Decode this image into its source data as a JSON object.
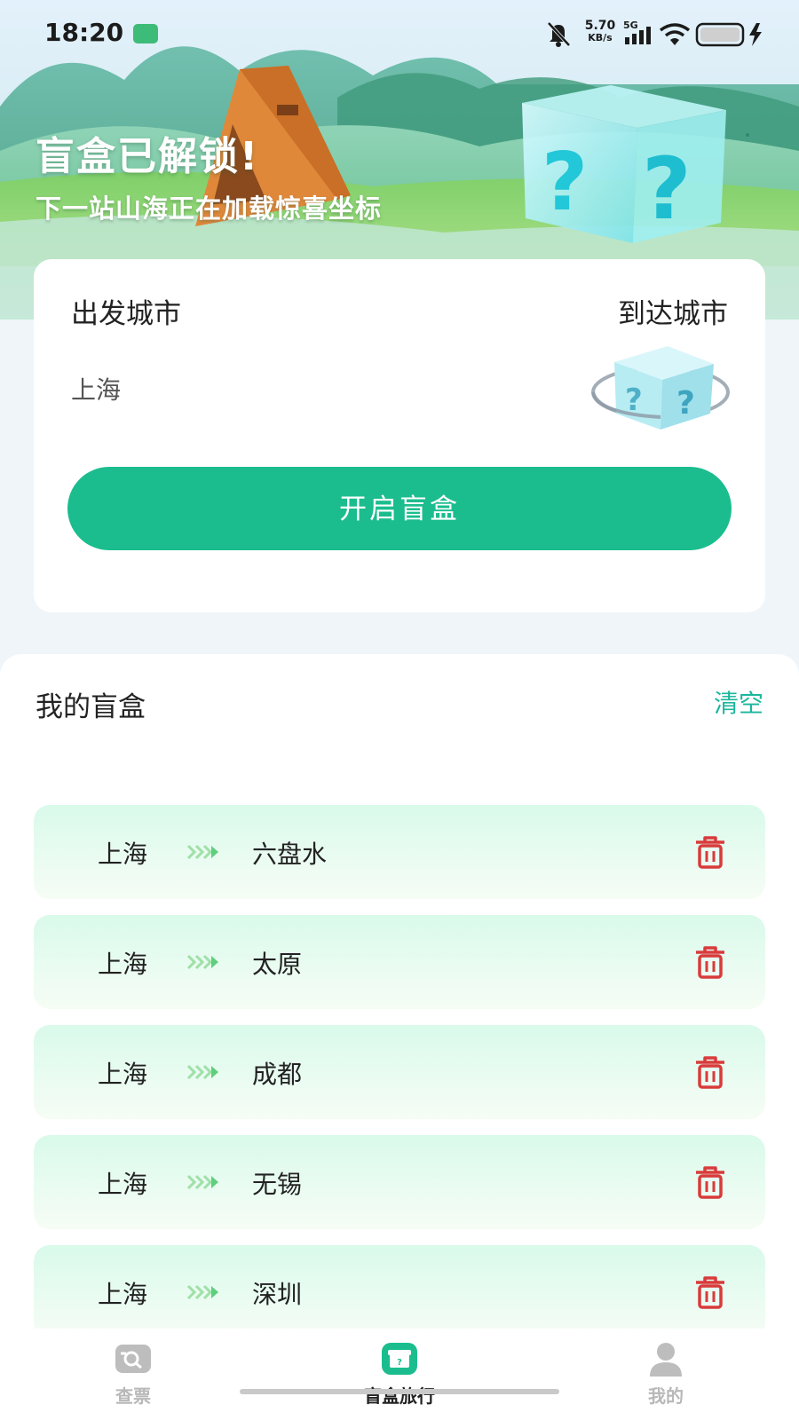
{
  "status_bar": {
    "time": "18:20",
    "net_speed_value": "5.70",
    "net_speed_unit": "KB/s",
    "network": "5G",
    "icons": [
      "app-notification-icon",
      "bell-mute-icon",
      "signal-icon",
      "wifi-icon",
      "battery-icon",
      "charging-icon"
    ]
  },
  "hero": {
    "title": "盲盒已解锁!",
    "subtitle": "下一站山海正在加载惊喜坐标"
  },
  "search_card": {
    "depart_label": "出发城市",
    "arrive_label": "到达城市",
    "depart_value": "上海",
    "open_button_label": "开启盲盒"
  },
  "my_boxes": {
    "title": "我的盲盒",
    "clear_label": "清空",
    "trips": [
      {
        "from": "上海",
        "to": "六盘水"
      },
      {
        "from": "上海",
        "to": "太原"
      },
      {
        "from": "上海",
        "to": "成都"
      },
      {
        "from": "上海",
        "to": "无锡"
      },
      {
        "from": "上海",
        "to": "深圳"
      }
    ]
  },
  "bottom_nav": {
    "items": [
      {
        "label": "查票",
        "icon": "ticket-search-icon",
        "active": false
      },
      {
        "label": "盲盒旅行",
        "icon": "gift-box-icon",
        "active": true
      },
      {
        "label": "我的",
        "icon": "user-icon",
        "active": false
      }
    ]
  },
  "colors": {
    "accent": "#1bbd8e",
    "clear_text": "#1bb79d",
    "trash_icon": "#d93b3b",
    "arrow": "#7fd59a"
  }
}
